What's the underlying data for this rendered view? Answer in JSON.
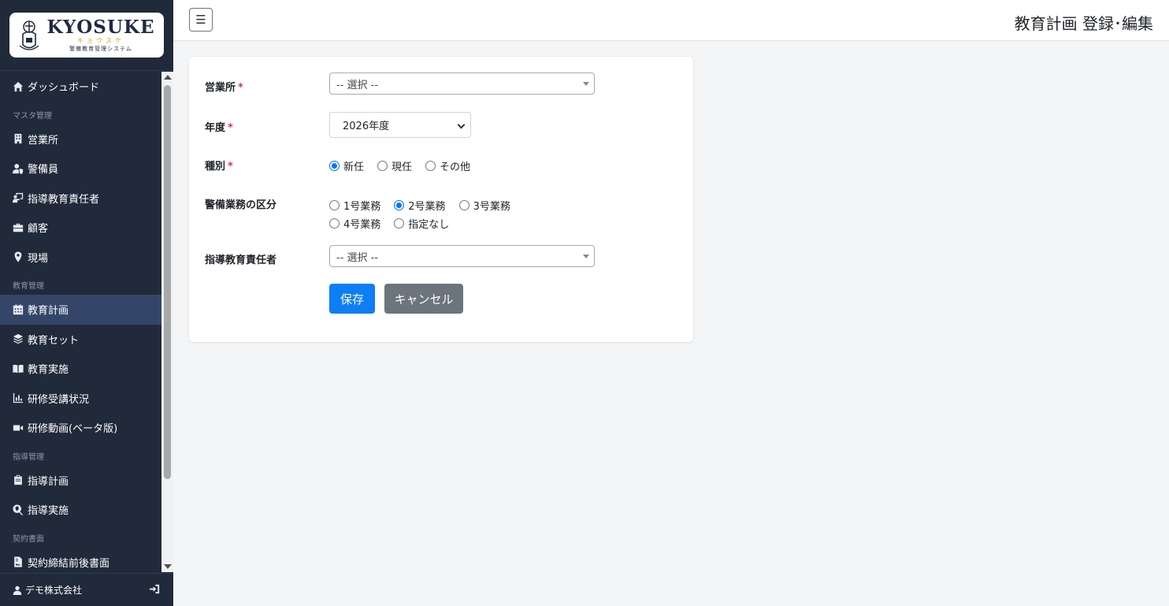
{
  "brand": {
    "name": "KYOSUKE",
    "kana": "キョウスケ",
    "subtitle": "警備教育管理システム"
  },
  "header": {
    "title": "教育計画 登録･編集",
    "menu_toggle_icon": "hamburger-icon"
  },
  "sidebar": {
    "items": [
      {
        "type": "item",
        "label": "ダッシュボード",
        "icon": "home-icon"
      },
      {
        "type": "section",
        "label": "マスタ管理"
      },
      {
        "type": "item",
        "label": "営業所",
        "icon": "building-icon"
      },
      {
        "type": "item",
        "label": "警備員",
        "icon": "user-shield-icon"
      },
      {
        "type": "item",
        "label": "指導教育責任者",
        "icon": "chalkboard-teacher-icon"
      },
      {
        "type": "item",
        "label": "顧客",
        "icon": "briefcase-icon"
      },
      {
        "type": "item",
        "label": "現場",
        "icon": "map-marker-icon"
      },
      {
        "type": "section",
        "label": "教育管理"
      },
      {
        "type": "item",
        "label": "教育計画",
        "icon": "calendar-icon",
        "active": true
      },
      {
        "type": "item",
        "label": "教育セット",
        "icon": "layers-icon"
      },
      {
        "type": "item",
        "label": "教育実施",
        "icon": "book-open-icon"
      },
      {
        "type": "item",
        "label": "研修受講状況",
        "icon": "chart-bar-icon"
      },
      {
        "type": "item",
        "label": "研修動画(ベータ版)",
        "icon": "video-icon"
      },
      {
        "type": "section",
        "label": "指導管理"
      },
      {
        "type": "item",
        "label": "指導計画",
        "icon": "clipboard-icon"
      },
      {
        "type": "item",
        "label": "指導実施",
        "icon": "search-location-icon"
      },
      {
        "type": "section",
        "label": "契約書面"
      },
      {
        "type": "item",
        "label": "契約締結前後書面",
        "icon": "file-contract-icon"
      }
    ],
    "footer": {
      "user": "デモ株式会社",
      "user_icon": "user-icon",
      "logout_icon": "logout-icon"
    }
  },
  "form": {
    "office": {
      "label": "営業所",
      "required_mark": "*",
      "placeholder": "-- 選択 --"
    },
    "year": {
      "label": "年度",
      "required_mark": "*",
      "value": "2026年度"
    },
    "type": {
      "label": "種別",
      "required_mark": "*",
      "options": [
        "新任",
        "現任",
        "その他"
      ],
      "selected": "新任"
    },
    "category": {
      "label": "警備業務の区分",
      "options": [
        "1号業務",
        "2号業務",
        "3号業務",
        "4号業務",
        "指定なし"
      ],
      "selected": "2号業務"
    },
    "instructor": {
      "label": "指導教育責任者",
      "placeholder": "-- 選択 --"
    },
    "save_label": "保存",
    "cancel_label": "キャンセル"
  },
  "colors": {
    "sidebar_bg": "#212a3a",
    "sidebar_active": "#33466a",
    "primary": "#0d7ef5",
    "secondary": "#6c757d",
    "required": "#dc3545",
    "brand_navy": "#1f2a44",
    "brand_gold": "#e0a12a"
  }
}
